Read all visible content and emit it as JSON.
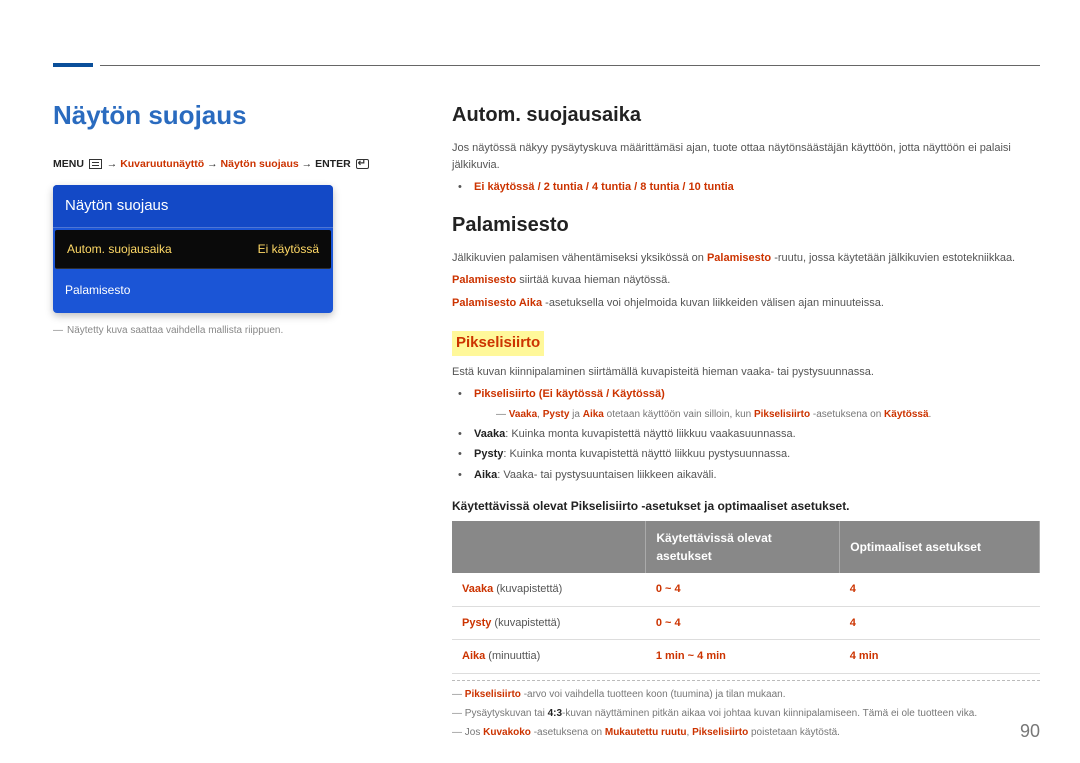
{
  "section_title": "Näytön suojaus",
  "breadcrumb": {
    "menu": "MENU",
    "path": [
      "Kuvaruutunäyttö",
      "Näytön suojaus"
    ],
    "enter": "ENTER"
  },
  "panel": {
    "title": "Näytön suojaus",
    "rows": [
      {
        "label": "Autom. suojausaika",
        "value": "Ei käytössä",
        "selected": true
      },
      {
        "label": "Palamisesto",
        "value": "",
        "selected": false
      }
    ]
  },
  "caption_note": "Näytetty kuva saattaa vaihdella mallista riippuen.",
  "right": {
    "autom": {
      "title": "Autom. suojausaika",
      "intro": "Jos näytössä näkyy pysäytyskuva määrittämäsi ajan, tuote ottaa näytönsäästäjän käyttöön, jotta näyttöön ei palaisi jälkikuvia.",
      "options_raw": "Ei käytössä / 2 tuntia / 4 tuntia / 8 tuntia / 10 tuntia"
    },
    "palamisesto": {
      "title": "Palamisesto",
      "p1_a": "Jälkikuvien palamisen vähentämiseksi yksikössä on ",
      "p1_b": " -ruutu, jossa käytetään jälkikuvien estotekniikkaa.",
      "p2_a": "Palamisesto",
      "p2_b": " siirtää kuvaa hieman näytössä.",
      "p3_a": "Palamisesto Aika",
      "p3_b": " -asetuksella voi ohjelmoida kuvan liikkeiden välisen ajan minuuteissa."
    },
    "pikselisiirto": {
      "title": "Pikselisiirto",
      "intro": "Estä kuvan kiinnipalaminen siirtämällä kuvapisteitä hieman vaaka- tai pystysuunnassa.",
      "opt_line": "Pikselisiirto (Ei käytössä / Käytössä)",
      "note1_pre": "Vaaka",
      "note1_mid1": ", ",
      "note1_mid2": "Pysty",
      "note1_mid3": " ja ",
      "note1_mid4": "Aika",
      "note1_mid5": " otetaan käyttöön vain silloin, kun ",
      "note1_mid6": "Pikselisiirto",
      "note1_mid7": " -asetuksena on ",
      "note1_mid8": "Käytössä",
      "note1_end": ".",
      "b_vaaka": "Vaaka",
      "b_vaaka_t": ": Kuinka monta kuvapistettä näyttö liikkuu vaakasuunnassa.",
      "b_pysty": "Pysty",
      "b_pysty_t": ": Kuinka monta kuvapistettä näyttö liikkuu pystysuunnassa.",
      "b_aika": "Aika",
      "b_aika_t": ": Vaaka- tai pystysuuntaisen liikkeen aikaväli.",
      "table_caption": "Käytettävissä olevat Pikselisiirto -asetukset ja optimaaliset asetukset.",
      "table": {
        "head": [
          "",
          "Käytettävissä olevat asetukset",
          "Optimaaliset asetukset"
        ],
        "rows": [
          {
            "label": "Vaaka",
            "unit": " (kuvapistettä)",
            "avail": "0 ~ 4",
            "opt": "4"
          },
          {
            "label": "Pysty",
            "unit": " (kuvapistettä)",
            "avail": "0 ~ 4",
            "opt": "4"
          },
          {
            "label": "Aika",
            "unit": " (minuuttia)",
            "avail": "1 min ~ 4 min",
            "opt": "4 min"
          }
        ]
      },
      "foot_notes": [
        "Pikselisiirto -arvo voi vaihdella tuotteen koon (tuumina) ja tilan mukaan.",
        "Pysäytyskuvan tai 4:3-kuvan näyttäminen pitkän aikaa voi johtaa kuvan kiinnipalamiseen. Tämä ei ole tuotteen vika.",
        "Jos Kuvakoko -asetuksena on Mukautettu ruutu, Pikselisiirto poistetaan käytöstä."
      ]
    }
  },
  "page_number": "90"
}
